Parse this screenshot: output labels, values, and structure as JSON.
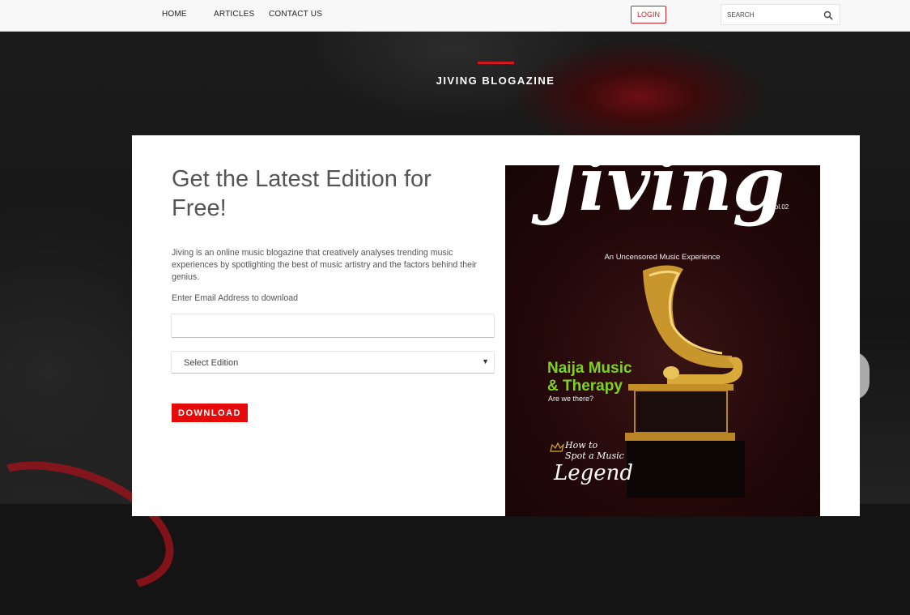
{
  "nav": {
    "home": "HOME",
    "articles": "ARTICLES",
    "contact": "CONTACT US",
    "login": "LOGIN",
    "search_placeholder": "SEARCH",
    "search_icon": "search-icon"
  },
  "hero": {
    "title": "JIVING BLOGAZINE",
    "accent_color": "#d1181e"
  },
  "card": {
    "heading": "Get the Latest Edition for Free!",
    "description": "Jiving is an online music blogazine that creatively analyses trending music experiences by spotlighting the best of music artistry and the factors behind their genius.",
    "email_label": "Enter Email Address to download",
    "email_value": "",
    "edition_selected": "Select Edition",
    "download_label": "DOWNLOAD",
    "button_color": "#e60b0b"
  },
  "cover": {
    "brand": "Jiving",
    "volume": "Vol.02",
    "tagline": "An Uncensored Music Experience",
    "headline_line1": "Naija Music",
    "headline_line2": "& Therapy",
    "subhead": "Are we there?",
    "feature_line1": "How to",
    "feature_line2": "Spot a Music",
    "feature_line3": "Legend",
    "headline_color": "#7ed321"
  }
}
